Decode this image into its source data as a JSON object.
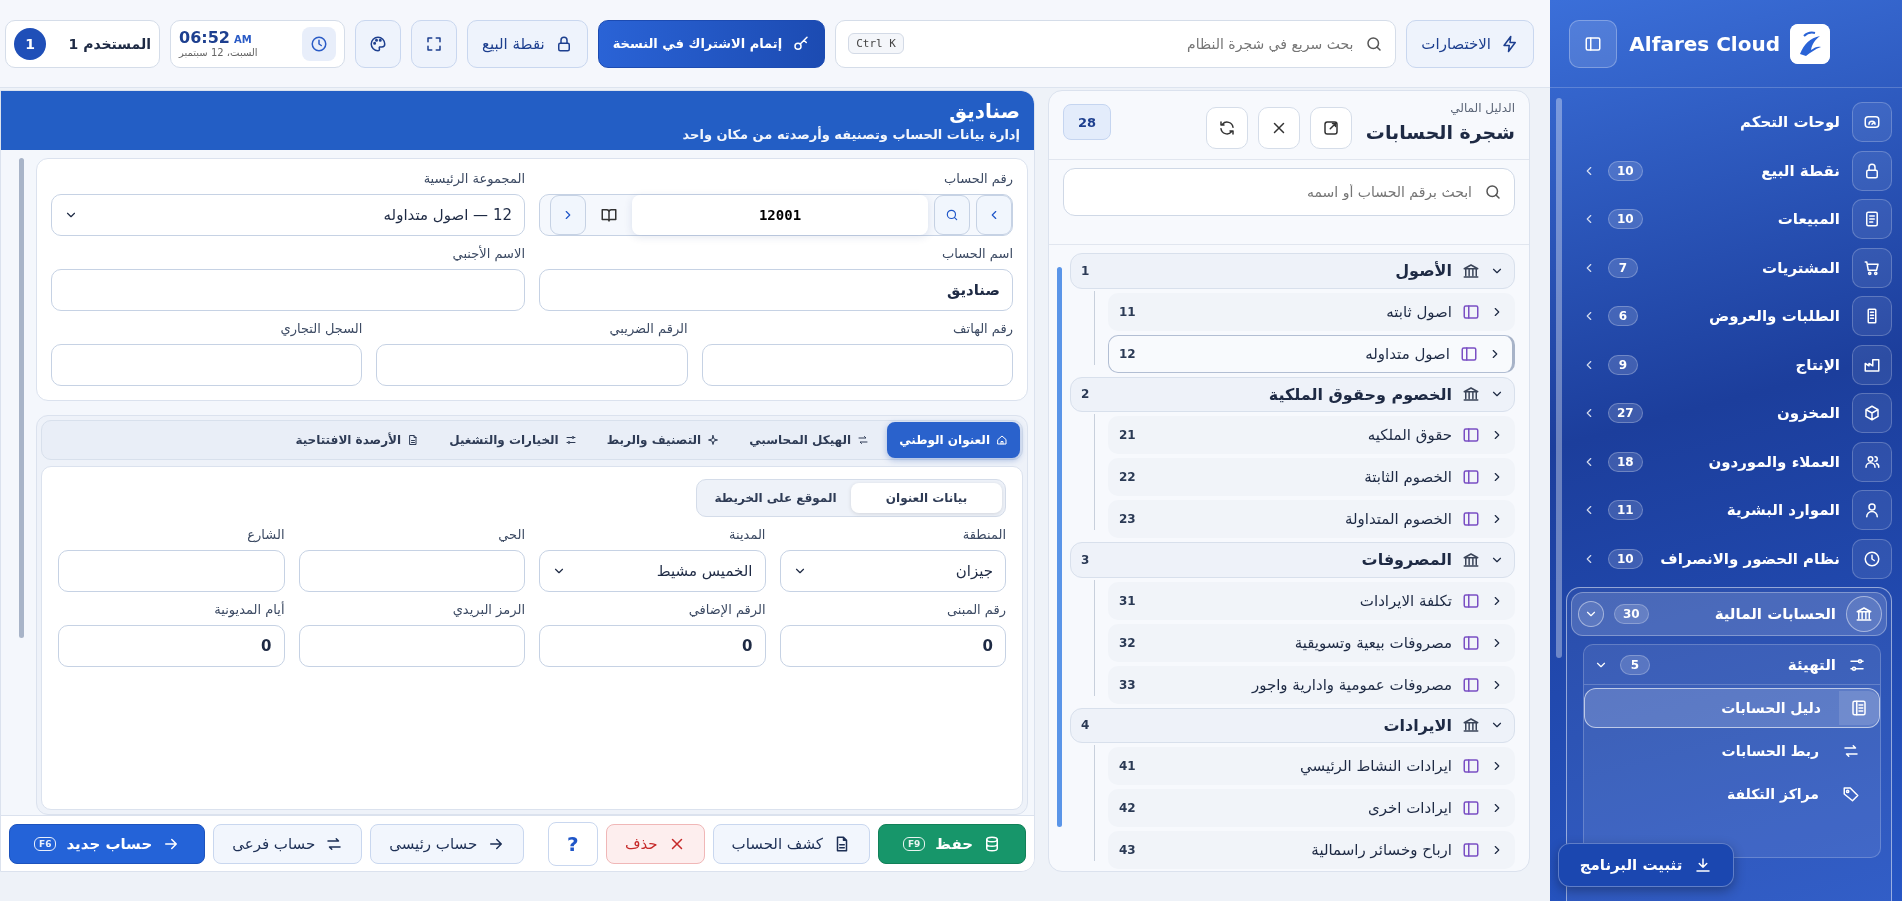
{
  "sidebar": {
    "brand": "Alfares Cloud",
    "items": [
      {
        "label": "لوحات التحكم"
      },
      {
        "label": "نقطة البيع",
        "badge": "10",
        "expanded": false
      },
      {
        "label": "المبيعات",
        "badge": "10",
        "expanded": false
      },
      {
        "label": "المشتريات",
        "badge": "7",
        "expanded": false
      },
      {
        "label": "الطلبات والعروض",
        "badge": "6",
        "expanded": false
      },
      {
        "label": "الإنتاج",
        "badge": "9",
        "expanded": false
      },
      {
        "label": "المخزون",
        "badge": "27",
        "expanded": false
      },
      {
        "label": "العملاء والموردون",
        "badge": "18",
        "expanded": false
      },
      {
        "label": "الموارد البشرية",
        "badge": "11",
        "expanded": false
      },
      {
        "label": "نظام الحضور والانصراف",
        "badge": "10",
        "expanded": false
      },
      {
        "label": "الحسابات المالية",
        "badge": "30",
        "expanded": true,
        "children": [
          {
            "label": "التهيئة",
            "badge": "5",
            "expanded": true,
            "children": [
              {
                "label": "دليل الحسابات",
                "selected": true
              },
              {
                "label": "ربط الحسابات",
                "selected": false
              },
              {
                "label": "مراكز التكلفة",
                "selected": false
              }
            ]
          }
        ]
      }
    ],
    "install_button": "تثبيت البرنامج"
  },
  "top_bar": {
    "shortcuts_button": "الاختصارات",
    "search": {
      "placeholder": "بحث سريع في شجرة النظام",
      "shortcut": "Ctrl K"
    },
    "subscribe_button": "إتمام الاشتراك في النسخة",
    "pos_button": "نقطة البيع",
    "clock": {
      "time": "06:52",
      "meridiem": "AM",
      "date": "السبت، 12 سبتمبر"
    },
    "user": {
      "label": "المستخدم 1",
      "badge": "1"
    }
  },
  "tree": {
    "caption": "الدليل المالي",
    "title": "شجرة الحسابات",
    "count": "28",
    "search": {
      "placeholder": "ابحث برقم الحساب أو اسمه"
    },
    "groups": [
      {
        "code": "1",
        "name": "الأصول",
        "expanded": true,
        "children": [
          {
            "code": "11",
            "name": "اصول ثابته",
            "selected": false
          },
          {
            "code": "12",
            "name": "اصول متداوله",
            "selected": true
          }
        ]
      },
      {
        "code": "2",
        "name": "الخصوم وحقوق الملكية",
        "expanded": true,
        "children": [
          {
            "code": "21",
            "name": "حقوق الملكيه",
            "selected": false
          },
          {
            "code": "22",
            "name": "الخصوم الثابتة",
            "selected": false
          },
          {
            "code": "23",
            "name": "الخصوم المتداولة",
            "selected": false
          }
        ]
      },
      {
        "code": "3",
        "name": "المصروفات",
        "expanded": true,
        "children": [
          {
            "code": "31",
            "name": "تكلفة الايرادات",
            "selected": false
          },
          {
            "code": "32",
            "name": "مصروفات بيعية وتسويقية",
            "selected": false
          },
          {
            "code": "33",
            "name": "مصروفات عمومية وادارية واجور",
            "selected": false
          }
        ]
      },
      {
        "code": "4",
        "name": "الايرادات",
        "expanded": true,
        "children": [
          {
            "code": "41",
            "name": "ايرادات النشاط الرئيسي",
            "selected": false
          },
          {
            "code": "42",
            "name": "ايرادات اخرى",
            "selected": false
          },
          {
            "code": "43",
            "name": "ارباح وخسائر راسمالية",
            "selected": false
          }
        ]
      }
    ]
  },
  "form": {
    "title": "صناديق",
    "subtitle": "إدارة بيانات الحساب وتصنيفه وأرصدته من مكان واحد",
    "fields": [
      {
        "kind": "account_number",
        "label": "رقم الحساب",
        "value": "12001"
      },
      {
        "kind": "select",
        "label": "المجموعة الرئيسية",
        "value": "12 — اصول متداوله"
      },
      {
        "kind": "text",
        "label": "اسم الحساب",
        "value": "صناديق"
      },
      {
        "kind": "text",
        "label": "الاسم الأجنبي"
      },
      {
        "kind": "text",
        "label": "رقم الهاتف"
      },
      {
        "kind": "text",
        "label": "الرقم الضريبي"
      },
      {
        "kind": "text",
        "label": "السجل التجاري"
      }
    ],
    "tabs": [
      {
        "label": "العنوان الوطني",
        "selected": true
      },
      {
        "label": "الهيكل المحاسبي",
        "selected": false
      },
      {
        "label": "التصنيف والربط",
        "selected": false
      },
      {
        "label": "الخيارات والتشغيل",
        "selected": false
      },
      {
        "label": "الأرصدة الافتتاحية",
        "selected": false
      }
    ],
    "address_tabs": [
      {
        "label": "بيانات العنوان",
        "selected": true
      },
      {
        "label": "الموقع على الخريطة",
        "selected": false
      }
    ],
    "address_fields": [
      {
        "kind": "select",
        "label": "المنطقة",
        "value": "جيزان"
      },
      {
        "kind": "select",
        "label": "المدينة",
        "value": "الخميس مشيط"
      },
      {
        "kind": "text",
        "label": "الحي"
      },
      {
        "kind": "text",
        "label": "الشارع"
      },
      {
        "kind": "text",
        "label": "رقم المبنى",
        "value": "0"
      },
      {
        "kind": "text",
        "label": "الرقم الإضافي",
        "value": "0"
      },
      {
        "kind": "text",
        "label": "الرمز البريدي"
      },
      {
        "kind": "text",
        "label": "أيام المديونية",
        "value": "0"
      }
    ],
    "actions": [
      {
        "kind": "save",
        "label": "حفظ",
        "shortcut": "F9"
      },
      {
        "kind": "statement",
        "label": "كشف الحساب"
      },
      {
        "kind": "delete",
        "label": "حذف"
      },
      {
        "kind": "help",
        "label": "?"
      }
    ],
    "create_actions": [
      {
        "kind": "plain",
        "label": "حساب رئيسى"
      },
      {
        "kind": "plain",
        "label": "حساب فرعى"
      },
      {
        "kind": "primary",
        "label": "حساب جديد",
        "shortcut": "F6"
      }
    ]
  }
}
